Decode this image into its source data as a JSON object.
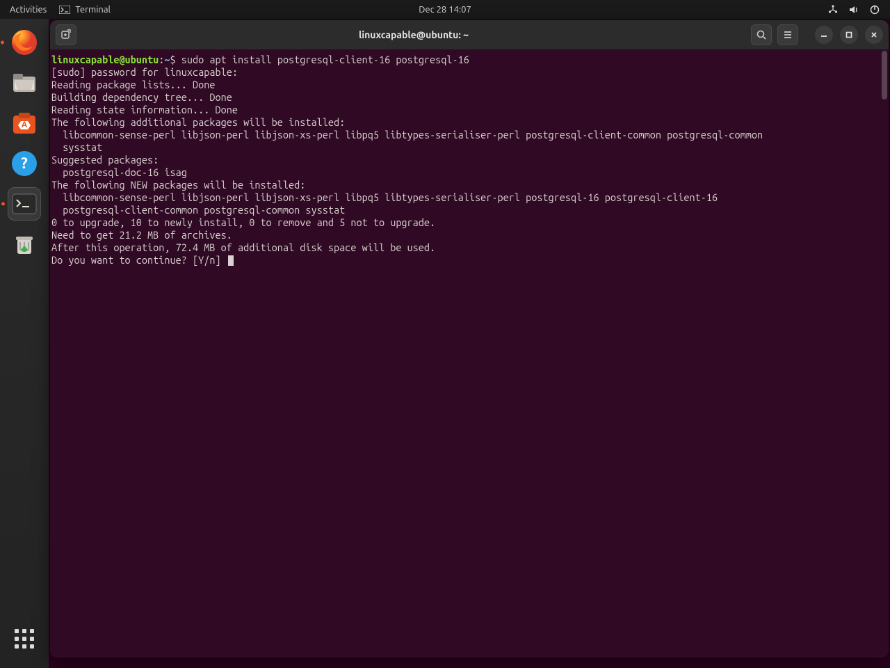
{
  "topbar": {
    "activities": "Activities",
    "app_name": "Terminal",
    "clock": "Dec 28  14:07"
  },
  "dock": {
    "items": [
      {
        "name": "firefox"
      },
      {
        "name": "files"
      },
      {
        "name": "software"
      },
      {
        "name": "help"
      },
      {
        "name": "terminal"
      },
      {
        "name": "trash"
      }
    ]
  },
  "window": {
    "title": "linuxcapable@ubuntu: ~"
  },
  "prompt": {
    "user_host": "linuxcapable@ubuntu",
    "colon": ":",
    "path": "~",
    "symbol": "$",
    "command": "sudo apt install postgresql-client-16 postgresql-16"
  },
  "output_lines": [
    "[sudo] password for linuxcapable:",
    "Reading package lists... Done",
    "Building dependency tree... Done",
    "Reading state information... Done",
    "The following additional packages will be installed:",
    "  libcommon-sense-perl libjson-perl libjson-xs-perl libpq5 libtypes-serialiser-perl postgresql-client-common postgresql-common",
    "  sysstat",
    "Suggested packages:",
    "  postgresql-doc-16 isag",
    "The following NEW packages will be installed:",
    "  libcommon-sense-perl libjson-perl libjson-xs-perl libpq5 libtypes-serialiser-perl postgresql-16 postgresql-client-16",
    "  postgresql-client-common postgresql-common sysstat",
    "0 to upgrade, 10 to newly install, 0 to remove and 5 not to upgrade.",
    "Need to get 21.2 MB of archives.",
    "After this operation, 72.4 MB of additional disk space will be used.",
    "Do you want to continue? [Y/n] "
  ]
}
